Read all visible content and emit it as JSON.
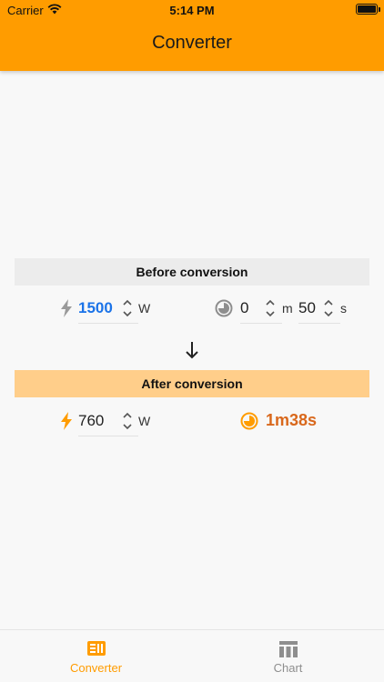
{
  "status_bar": {
    "carrier": "Carrier",
    "time": "5:14 PM"
  },
  "header": {
    "title": "Converter"
  },
  "before": {
    "title": "Before conversion",
    "power": {
      "value": "1500",
      "unit": "W"
    },
    "minutes": {
      "value": "0",
      "unit": "m"
    },
    "seconds": {
      "value": "50",
      "unit": "s"
    }
  },
  "after": {
    "title": "After conversion",
    "power": {
      "value": "760",
      "unit": "W"
    },
    "duration": "1m38s"
  },
  "tabbar": {
    "tabs": [
      {
        "label": "Converter",
        "selected": true,
        "icon": "converter-icon"
      },
      {
        "label": "Chart",
        "selected": false,
        "icon": "chart-icon"
      }
    ]
  },
  "colors": {
    "accent": "#ff9c00",
    "value_blue": "#1b73e8",
    "result_orange": "#d9681c",
    "tab_selected": "#ff9c00",
    "tab_unselected": "#8e8e8e"
  }
}
